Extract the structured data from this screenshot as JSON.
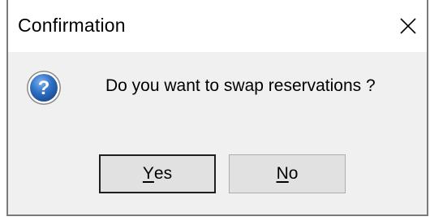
{
  "window": {
    "title": "Confirmation",
    "close_icon": "close-icon"
  },
  "message": {
    "icon": "question-icon",
    "text": "Do you want to swap reservations ?"
  },
  "buttons": {
    "yes": {
      "accel": "Y",
      "rest": "es"
    },
    "no": {
      "accel": "N",
      "rest": "o"
    }
  },
  "colors": {
    "titlebar_bg": "#ffffff",
    "content_bg": "#f0f0f0",
    "button_bg": "#e1e1e1",
    "icon_blue": "#1e5fb0"
  }
}
